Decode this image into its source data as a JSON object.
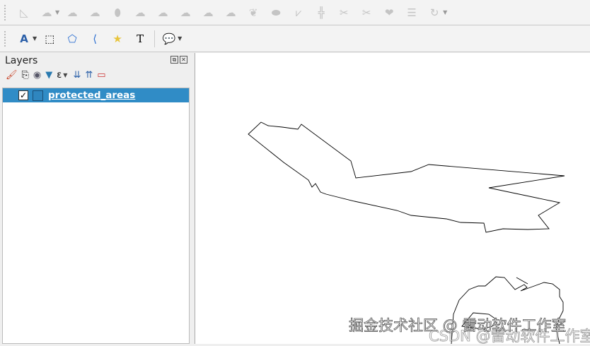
{
  "toolbar_digitizing": {
    "icons": [
      "measure-icon",
      "add-ring-icon",
      "fill-ring-icon",
      "add-part-icon",
      "rotate-feature-icon",
      "delete-ring-icon",
      "delete-part-icon",
      "reshape-icon",
      "offset-curve-icon",
      "split-features-icon",
      "split-parts-icon",
      "merge-features-icon",
      "merge-attributes-icon",
      "simplify-icon",
      "vertex-tool-icon",
      "node-tool-icon",
      "tracing-icon"
    ]
  },
  "toolbar_annotations": {
    "icons": [
      "text-annotation-icon",
      "select-annotation-icon",
      "polygon-annotation-icon",
      "line-annotation-icon",
      "marker-annotation-icon",
      "point-text-icon",
      "html-annotation-icon"
    ]
  },
  "layers_panel": {
    "title": "Layers",
    "float_glyph": "⧉",
    "close_glyph": "✕",
    "layers": [
      {
        "name": "protected_areas",
        "checked": true,
        "checkmark": "✓",
        "symbol_color": "#2f86bf"
      }
    ]
  },
  "colors": {
    "selection": "#308cc6"
  },
  "watermarks": {
    "juejin": "掘金技术社区 @ 雷动软件工作室",
    "csdn": "CSDN @雷动软件工作室"
  }
}
